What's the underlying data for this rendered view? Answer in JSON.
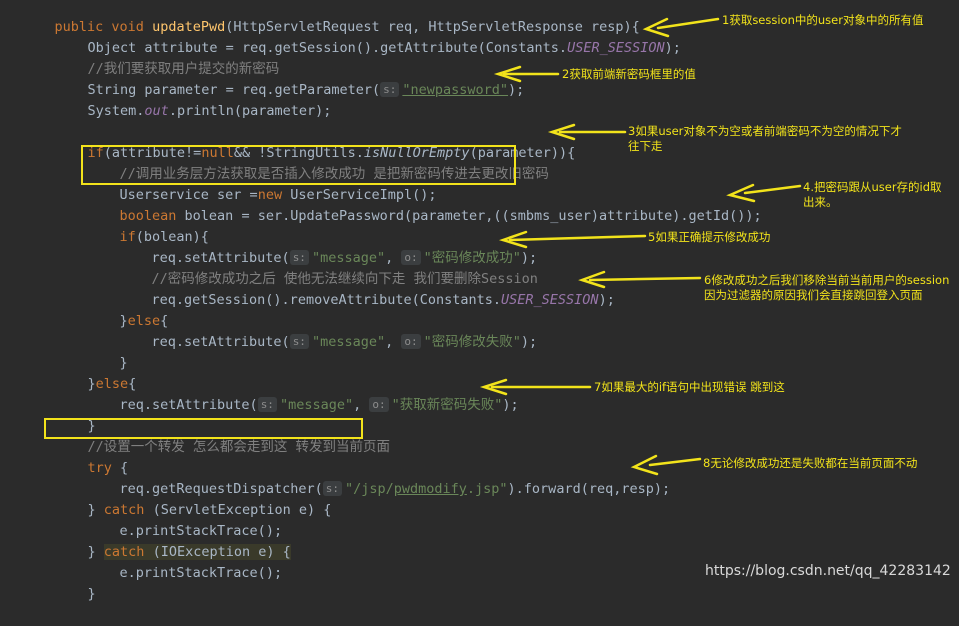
{
  "code": {
    "l1": {
      "kw1": "public void ",
      "fn": "updatePwd",
      "rest": "(HttpServletRequest req, HttpServletResponse resp){"
    },
    "l2": {
      "a": "Object attribute = req.getSession().getAttribute(Constants.",
      "c": "USER_SESSION",
      "b": ");"
    },
    "l3": {
      "cmt": "//我们要获取用户提交的新密码"
    },
    "l4": {
      "a": "String parameter = req.getParameter(",
      "hint": "s:",
      "str": "\"newpassword\"",
      "b": ");"
    },
    "l5": {
      "a": "System.",
      "s": "out",
      "b": ".println(parameter);"
    },
    "l6": {
      "kw": "if",
      "a": "(attribute!=",
      "kw2": "null",
      "b": "&& !StringUtils.",
      "s": "isNullOrEmpty",
      "c": "(parameter)){"
    },
    "l7": {
      "cmt": "//调用业务层方法获取是否插入修改成功 是把新密码传进去更改旧密码"
    },
    "l8": {
      "a": "Userservice ser =",
      "kw": "new ",
      "b": "UserServiceImpl();"
    },
    "l9": {
      "kw": "boolean ",
      "a": "bolean = ser.UpdatePassword(parameter,((smbms_user)attribute).getId());"
    },
    "l10": {
      "kw": "if",
      "a": "(bolean){"
    },
    "l11": {
      "a": "req.setAttribute(",
      "hint1": "s:",
      "str1": "\"message\"",
      ",": ", ",
      "hint2": "o:",
      "str2": "\"密码修改成功\"",
      "b": ");"
    },
    "l12": {
      "cmt": "//密码修改成功之后 使他无法继续向下走 我们要删除Session"
    },
    "l13": {
      "a": "req.getSession().removeAttribute(Constants.",
      "c": "USER_SESSION",
      "b": ");"
    },
    "l14": {
      "a": "}",
      "kw": "else",
      "b": "{"
    },
    "l15": {
      "a": "req.setAttribute(",
      "hint1": "s:",
      "str1": "\"message\"",
      ",": ", ",
      "hint2": "o:",
      "str2": "\"密码修改失败\"",
      "b": ");"
    },
    "l16": {
      "a": "}"
    },
    "l17": {
      "a": "}",
      "kw": "else",
      "b": "{"
    },
    "l18": {
      "a": "req.setAttribute(",
      "hint1": "s:",
      "str1": "\"message\"",
      ",": ", ",
      "hint2": "o:",
      "str2": "\"获取新密码失败\"",
      "b": ");"
    },
    "l19": {
      "a": "}"
    },
    "l20": {
      "cmt": "//设置一个转发 怎么都会走到这 转发到当前页面"
    },
    "l21": {
      "kw": "try ",
      "a": "{"
    },
    "l22": {
      "a": "req.getRequestDispatcher(",
      "hint": "s:",
      "str1": "\"/jsp/",
      "str2": "pwdmodify",
      "str3": ".jsp\"",
      "b": ").forward(req,resp);"
    },
    "l23": {
      "a": "} ",
      "kw": "catch ",
      "b": "(ServletException e) {"
    },
    "l24": {
      "a": "e.printStackTrace();"
    },
    "l25": {
      "a": "} ",
      "kw": "catch ",
      "b": "(IOException e) {"
    },
    "l26": {
      "a": "e.printStackTrace();"
    },
    "l27": {
      "a": "}"
    }
  },
  "annotations": {
    "a1": "1获取session中的user对象中的所有值",
    "a2": "2获取前端新密码框里的值",
    "a3_1": "3如果user对象不为空或者前端密码不为空的情况下才",
    "a3_2": "往下走",
    "a4_1": "4.把密码跟从user存的id取",
    "a4_2": "出来。",
    "a5": "5如果正确提示修改成功",
    "a6_1": "6修改成功之后我们移除当前当前用户的session",
    "a6_2": "因为过滤器的原因我们会直接跳回登入页面",
    "a7": "7如果最大的if语句中出现错误 跳到这",
    "a8": "8无论修改成功还是失败都在当前页面不动"
  },
  "colors": {
    "accent": "#f2e31b",
    "background": "#2b2b2b",
    "keyword": "#cc7832",
    "string": "#6a8759",
    "constant": "#9876aa",
    "method": "#ffc66d"
  },
  "watermark": "https://blog.csdn.net/qq_42283142"
}
